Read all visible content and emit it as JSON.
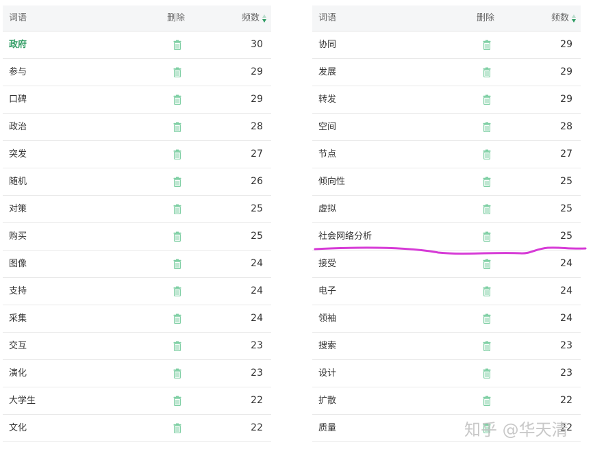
{
  "headers": {
    "word": "词语",
    "delete": "删除",
    "frequency": "频数"
  },
  "colors": {
    "accent": "#2e9b62",
    "trash_icon": "#7fcfa4",
    "annotation": "#d63ad6"
  },
  "icons": {
    "delete": "trash-icon",
    "sort": "sort-icon"
  },
  "left_rows": [
    {
      "word": "政府",
      "freq": "30"
    },
    {
      "word": "参与",
      "freq": "29"
    },
    {
      "word": "口碑",
      "freq": "29"
    },
    {
      "word": "政治",
      "freq": "28"
    },
    {
      "word": "突发",
      "freq": "27"
    },
    {
      "word": "随机",
      "freq": "26"
    },
    {
      "word": "对策",
      "freq": "25"
    },
    {
      "word": "购买",
      "freq": "25"
    },
    {
      "word": "图像",
      "freq": "24"
    },
    {
      "word": "支持",
      "freq": "24"
    },
    {
      "word": "采集",
      "freq": "24"
    },
    {
      "word": "交互",
      "freq": "23"
    },
    {
      "word": "演化",
      "freq": "23"
    },
    {
      "word": "大学生",
      "freq": "22"
    },
    {
      "word": "文化",
      "freq": "22"
    }
  ],
  "right_rows": [
    {
      "word": "协同",
      "freq": "29"
    },
    {
      "word": "发展",
      "freq": "29"
    },
    {
      "word": "转发",
      "freq": "29"
    },
    {
      "word": "空间",
      "freq": "28"
    },
    {
      "word": "节点",
      "freq": "27"
    },
    {
      "word": "倾向性",
      "freq": "25"
    },
    {
      "word": "虚拟",
      "freq": "25"
    },
    {
      "word": "社会网络分析",
      "freq": "25"
    },
    {
      "word": "接受",
      "freq": "24"
    },
    {
      "word": "电子",
      "freq": "24"
    },
    {
      "word": "领袖",
      "freq": "24"
    },
    {
      "word": "搜索",
      "freq": "23"
    },
    {
      "word": "设计",
      "freq": "23"
    },
    {
      "word": "扩散",
      "freq": "22"
    },
    {
      "word": "质量",
      "freq": "22"
    }
  ],
  "watermark": "知乎 @华天清"
}
